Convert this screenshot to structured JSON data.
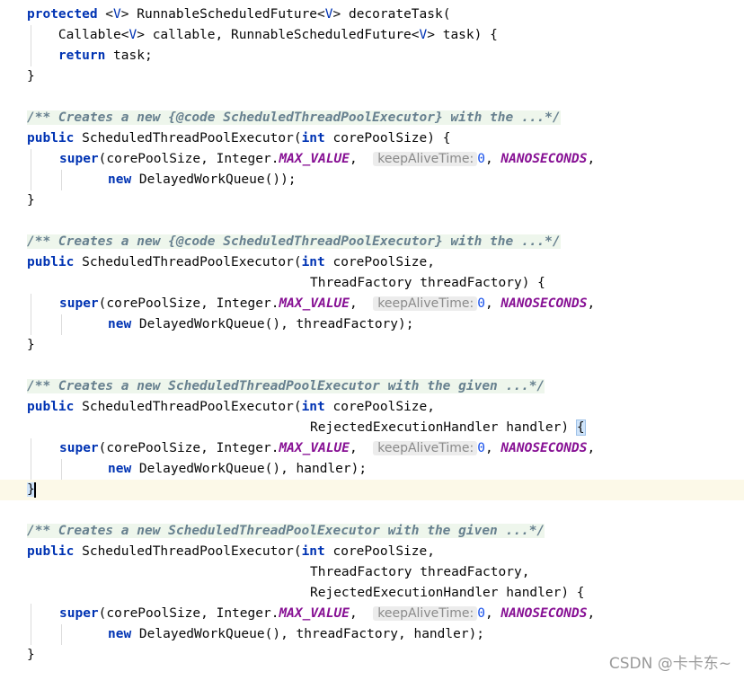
{
  "code": {
    "l1": {
      "kw": "protected",
      "t1": " <",
      "tp1": "V",
      "t2": "> RunnableScheduledFuture<",
      "tp2": "V",
      "t3": "> decorateTask("
    },
    "l2": {
      "t1": "    Callable<",
      "tp1": "V",
      "t2": "> callable, RunnableScheduledFuture<",
      "tp2": "V",
      "t3": "> task) {"
    },
    "l3": {
      "pre": "    ",
      "kw": "return",
      "t": " task;"
    },
    "l4": {
      "t": "}"
    },
    "block1": {
      "doc": "/** Creates a new {@code ScheduledThreadPoolExecutor} with the ...*/",
      "sig_kw": "public",
      "sig_t1": " ScheduledThreadPoolExecutor(",
      "sig_kw2": "int",
      "sig_t2": " corePoolSize) {",
      "super_kw": "super",
      "super_t1": "(corePoolSize, Integer.",
      "max": "MAX_VALUE",
      "super_t2": ",  ",
      "hint": "keepAliveTime:",
      "zero": "0",
      "super_t3": ", ",
      "nanos": "NANOSECONDS",
      "super_t4": ",",
      "new_kw": "new",
      "new_t": " DelayedWorkQueue());",
      "close": "}"
    },
    "block2": {
      "doc": "/** Creates a new {@code ScheduledThreadPoolExecutor} with the ...*/",
      "sig_kw": "public",
      "sig_t1": " ScheduledThreadPoolExecutor(",
      "sig_kw2": "int",
      "sig_t2": " corePoolSize,",
      "sig2": "ThreadFactory threadFactory) {",
      "super_kw": "super",
      "super_t1": "(corePoolSize, Integer.",
      "max": "MAX_VALUE",
      "super_t2": ",  ",
      "hint": "keepAliveTime:",
      "zero": "0",
      "super_t3": ", ",
      "nanos": "NANOSECONDS",
      "super_t4": ",",
      "new_kw": "new",
      "new_t": " DelayedWorkQueue(), threadFactory);",
      "close": "}"
    },
    "block3": {
      "doc": "/** Creates a new ScheduledThreadPoolExecutor with the given ...*/",
      "sig_kw": "public",
      "sig_t1": " ScheduledThreadPoolExecutor(",
      "sig_kw2": "int",
      "sig_t2": " corePoolSize,",
      "sig2": "RejectedExecutionHandler handler) ",
      "sig2_brace": "{",
      "super_kw": "super",
      "super_t1": "(corePoolSize, Integer.",
      "max": "MAX_VALUE",
      "super_t2": ",  ",
      "hint": "keepAliveTime:",
      "zero": "0",
      "super_t3": ", ",
      "nanos": "NANOSECONDS",
      "super_t4": ",",
      "new_kw": "new",
      "new_t": " DelayedWorkQueue(), handler);",
      "close": "}"
    },
    "block4": {
      "doc": "/** Creates a new ScheduledThreadPoolExecutor with the given ...*/",
      "sig_kw": "public",
      "sig_t1": " ScheduledThreadPoolExecutor(",
      "sig_kw2": "int",
      "sig_t2": " corePoolSize,",
      "sig2": "ThreadFactory threadFactory,",
      "sig3": "RejectedExecutionHandler handler) {",
      "super_kw": "super",
      "super_t1": "(corePoolSize, Integer.",
      "max": "MAX_VALUE",
      "super_t2": ",  ",
      "hint": "keepAliveTime:",
      "zero": "0",
      "super_t3": ", ",
      "nanos": "NANOSECONDS",
      "super_t4": ",",
      "new_kw": "new",
      "new_t": " DelayedWorkQueue(), threadFactory, handler);",
      "close": "}"
    }
  },
  "watermark": "CSDN @卡卡东~"
}
